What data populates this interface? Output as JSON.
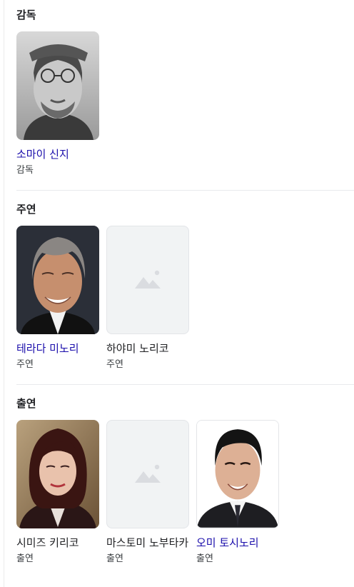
{
  "sections": [
    {
      "heading": "감독",
      "people": [
        {
          "name": "소마이 신지",
          "role": "감독",
          "has_photo": true,
          "link": true
        }
      ]
    },
    {
      "heading": "주연",
      "people": [
        {
          "name": "테라다 미노리",
          "role": "주연",
          "has_photo": true,
          "link": true
        },
        {
          "name": "하야미 노리코",
          "role": "주연",
          "has_photo": false,
          "link": false
        }
      ]
    },
    {
      "heading": "출연",
      "people": [
        {
          "name": "시미즈 키리코",
          "role": "출연",
          "has_photo": true,
          "link": false
        },
        {
          "name": "마스토미 노부타카",
          "role": "출연",
          "has_photo": false,
          "link": false
        },
        {
          "name": "오미 토시노리",
          "role": "출연",
          "has_photo": true,
          "link": true
        }
      ]
    }
  ],
  "colors": {
    "link": "#1a0dab",
    "text": "#202124",
    "secondary": "#3c4043",
    "placeholder_bg": "#f1f3f4",
    "placeholder_icon": "#dadce0"
  },
  "icons": {
    "placeholder": "image-placeholder-icon"
  }
}
